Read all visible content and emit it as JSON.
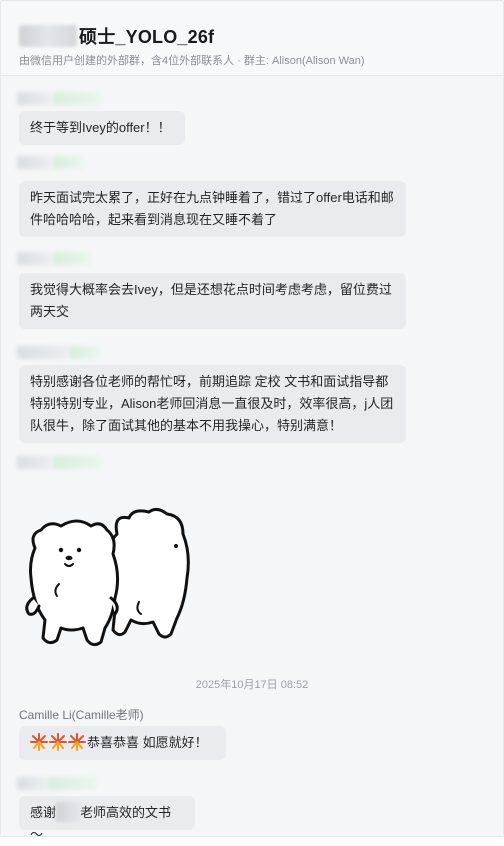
{
  "header": {
    "title": "硕士_YOLO_26f",
    "subtitle": "由微信用户创建的外部群，含4位外部联系人 · 群主: Alison(Alison Wan)"
  },
  "messages": [
    {
      "text": "终于等到Ivey的offer！！"
    },
    {
      "text": "昨天面试完太累了，正好在九点钟睡着了，错过了offer电话和邮件哈哈哈哈，起来看到消息现在又睡不着了"
    },
    {
      "text": "我觉得大概率会去Ivey，但是还想花点时间考虑考虑，留位费过两天交"
    },
    {
      "text": "特别感谢各位老师的帮忙呀，前期追踪 定校 文书和面试指导都特别特别专业，Alison老师回消息一直很及时，效率很高，j人团队很牛，除了面试其他的基本不用我操心，特别满意！"
    }
  ],
  "timestamp": "2025年10月17日 08:52",
  "reply": {
    "sender": "Camille Li(Camille老师)",
    "text": "恭喜恭喜 如愿就好！"
  },
  "last": {
    "prefix": "感谢",
    "suffix": "老师高效的文书～"
  },
  "icons": [
    "firework-icon",
    "firework-icon",
    "firework-icon"
  ]
}
